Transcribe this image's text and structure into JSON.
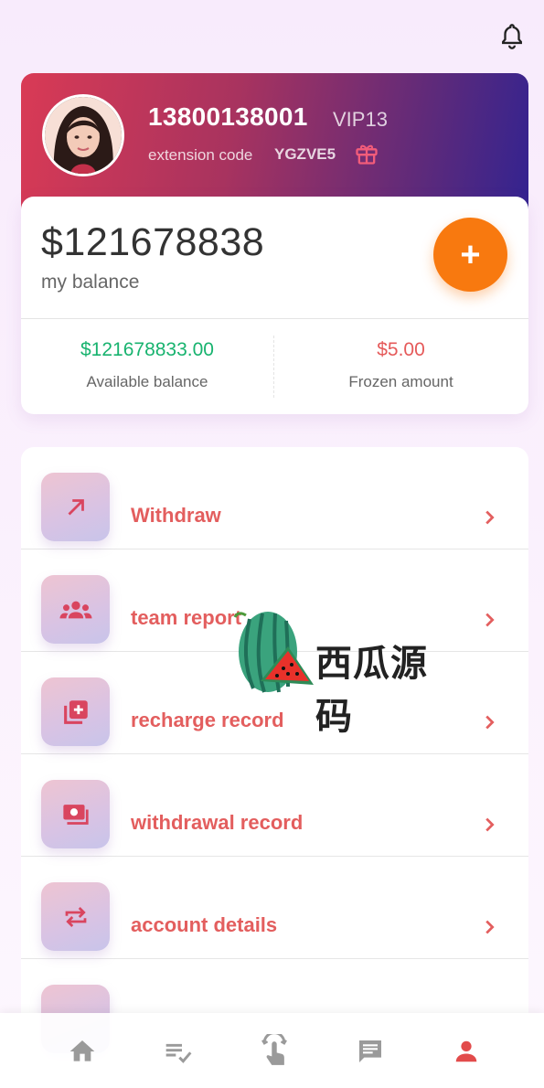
{
  "header": {
    "notification_icon": "bell-icon"
  },
  "profile": {
    "phone": "13800138001",
    "vip": "VIP13",
    "extension_label": "extension code",
    "extension_code": "YGZVE5",
    "gift_icon": "gift-icon"
  },
  "balance": {
    "amount": "$121678838",
    "label": "my balance",
    "add_button": "+",
    "available_value": "$121678833.00",
    "available_label": "Available balance",
    "frozen_value": "$5.00",
    "frozen_label": "Frozen amount"
  },
  "menu": {
    "items": [
      {
        "label": "Withdraw",
        "icon": "arrow-up-right-icon"
      },
      {
        "label": "team report",
        "icon": "group-icon"
      },
      {
        "label": "recharge record",
        "icon": "library-add-icon"
      },
      {
        "label": "withdrawal record",
        "icon": "money-icon"
      },
      {
        "label": "account details",
        "icon": "repeat-icon"
      }
    ]
  },
  "watermark": {
    "text": "西瓜源码"
  },
  "bottom_nav": {
    "items": [
      {
        "icon": "home-icon",
        "active": false
      },
      {
        "icon": "checklist-icon",
        "active": false
      },
      {
        "icon": "tap-icon",
        "active": false
      },
      {
        "icon": "chat-icon",
        "active": false
      },
      {
        "icon": "person-icon",
        "active": true
      }
    ]
  },
  "colors": {
    "accent_orange": "#f8790f",
    "menu_text": "#e35e5e",
    "available_green": "#18b36f",
    "frozen_red": "#e55a5a",
    "nav_active": "#e24b4b",
    "nav_inactive": "#9a9a9a"
  }
}
